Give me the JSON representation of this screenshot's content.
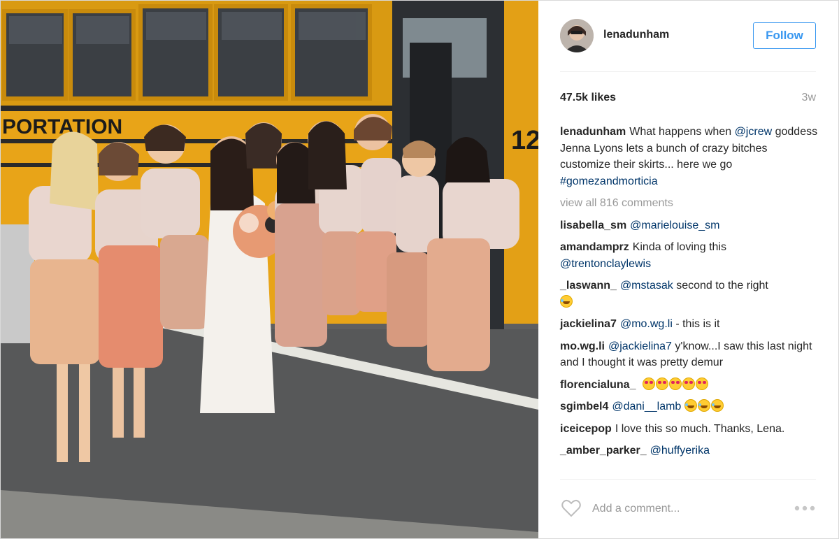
{
  "post": {
    "username": "lenadunham",
    "follow_label": "Follow",
    "likes": "47.5k likes",
    "time_ago": "3w",
    "caption": {
      "user": "lenadunham",
      "text_1": "What happens when",
      "mention": "@jcrew",
      "text_2": "goddess Jenna Lyons lets a bunch of crazy bitches customize their skirts... here we go",
      "hashtag": "#gomezandmorticia"
    },
    "view_all": "view all 816 comments",
    "comments": [
      {
        "user": "lisabella_sm",
        "mention": "@marielouise_sm",
        "text": ""
      },
      {
        "user": "amandamprz",
        "mention": "",
        "text": "Kinda of loving this",
        "mention_after": "@trentonclaylewis"
      },
      {
        "user": "_laswann_",
        "mention": "@mstasak",
        "text": "second to the right"
      },
      {
        "user": "jackielina7",
        "mention": "@mo.wg.li",
        "text": "- this is it"
      },
      {
        "user": "mo.wg.li",
        "mention": "@jackielina7",
        "text": "y'know...I saw this last night and I thought it was pretty demur"
      },
      {
        "user": "florencialuna_",
        "mention": "",
        "text": ""
      },
      {
        "user": "sgimbel4",
        "mention": "@dani__lamb",
        "text": ""
      },
      {
        "user": "iceicepop",
        "mention": "",
        "text": "I love this so much. Thanks, Lena."
      },
      {
        "user": "_amber_parker_",
        "mention": "@huffyerika",
        "text": ""
      }
    ],
    "add_comment_placeholder": "Add a comment...",
    "icons": {
      "like": "heart-outline-icon",
      "more": "more-options-icon"
    },
    "colors": {
      "accent": "#3897f0",
      "mention": "#003569",
      "muted": "#999999"
    }
  }
}
